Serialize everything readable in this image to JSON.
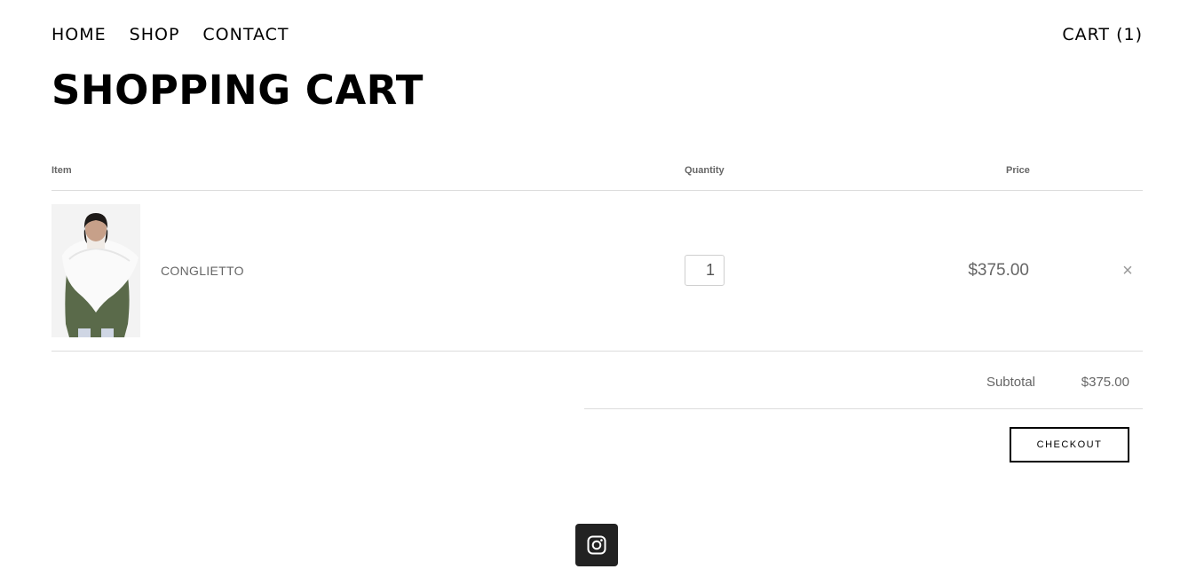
{
  "nav": {
    "items": [
      {
        "label": "HOME"
      },
      {
        "label": "SHOP"
      },
      {
        "label": "CONTACT"
      }
    ],
    "cart_label": "CART (1)"
  },
  "page_title": "SHOPPING CART",
  "table": {
    "headers": {
      "item": "Item",
      "quantity": "Quantity",
      "price": "Price"
    },
    "rows": [
      {
        "name": "CONGLIETTO",
        "quantity": "1",
        "price": "$375.00",
        "remove_symbol": "×",
        "image_icon": "product-photo"
      }
    ]
  },
  "summary": {
    "subtotal_label": "Subtotal",
    "subtotal_value": "$375.00",
    "checkout_label": "CHECKOUT"
  },
  "footer": {
    "social_icon": "instagram-icon"
  },
  "colors": {
    "text": "#000000",
    "muted": "#666666",
    "rule": "#dcdcdc",
    "icon_bg": "#222222"
  }
}
